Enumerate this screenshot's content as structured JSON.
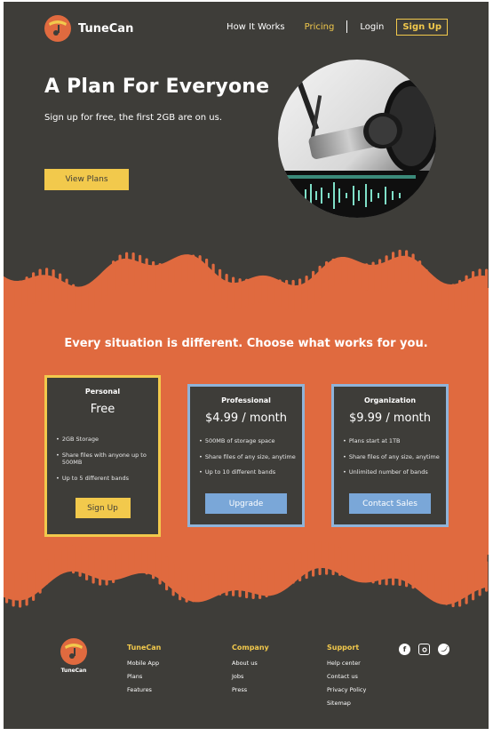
{
  "brand": {
    "name": "TuneCan",
    "accent": "#e06a3f",
    "yellow": "#f2c94c",
    "blue": "#7aa7d8",
    "dark": "#3e3d39"
  },
  "nav": {
    "items": [
      {
        "label": "How It Works",
        "active": false
      },
      {
        "label": "Pricing",
        "active": true
      }
    ],
    "login": "Login",
    "signup": "Sign Up"
  },
  "hero": {
    "title": "A Plan For Everyone",
    "subtitle": "Sign up for free, the first 2GB are on us.",
    "cta": "View Plans",
    "image": "studio-microphone-photo"
  },
  "plans_section": {
    "title": "Every situation is different. Choose what works for you.",
    "plans": [
      {
        "name": "Personal",
        "price": "Free",
        "features": [
          "2GB Storage",
          "Share files with anyone up to 500MB",
          "Up to 5 different bands"
        ],
        "cta": "Sign Up"
      },
      {
        "name": "Professional",
        "price": "$4.99 / month",
        "features": [
          "500MB of storage space",
          "Share files of any size, anytime",
          "Up to 10 different bands"
        ],
        "cta": "Upgrade"
      },
      {
        "name": "Organization",
        "price": "$9.99 / month",
        "features": [
          "Plans start at 1TB",
          "Share files of any size, anytime",
          "Unlimited number of bands"
        ],
        "cta": "Contact Sales"
      }
    ]
  },
  "footer": {
    "logo_name": "TuneCan",
    "columns": [
      {
        "title": "TuneCan",
        "links": [
          "Mobile App",
          "Plans",
          "Features"
        ]
      },
      {
        "title": "Company",
        "links": [
          "About us",
          "Jobs",
          "Press"
        ]
      },
      {
        "title": "Support",
        "links": [
          "Help center",
          "Contact us",
          "Privacy Policy",
          "Sitemap"
        ]
      }
    ],
    "socials": [
      "facebook-icon",
      "instagram-icon",
      "twitter-icon"
    ]
  }
}
